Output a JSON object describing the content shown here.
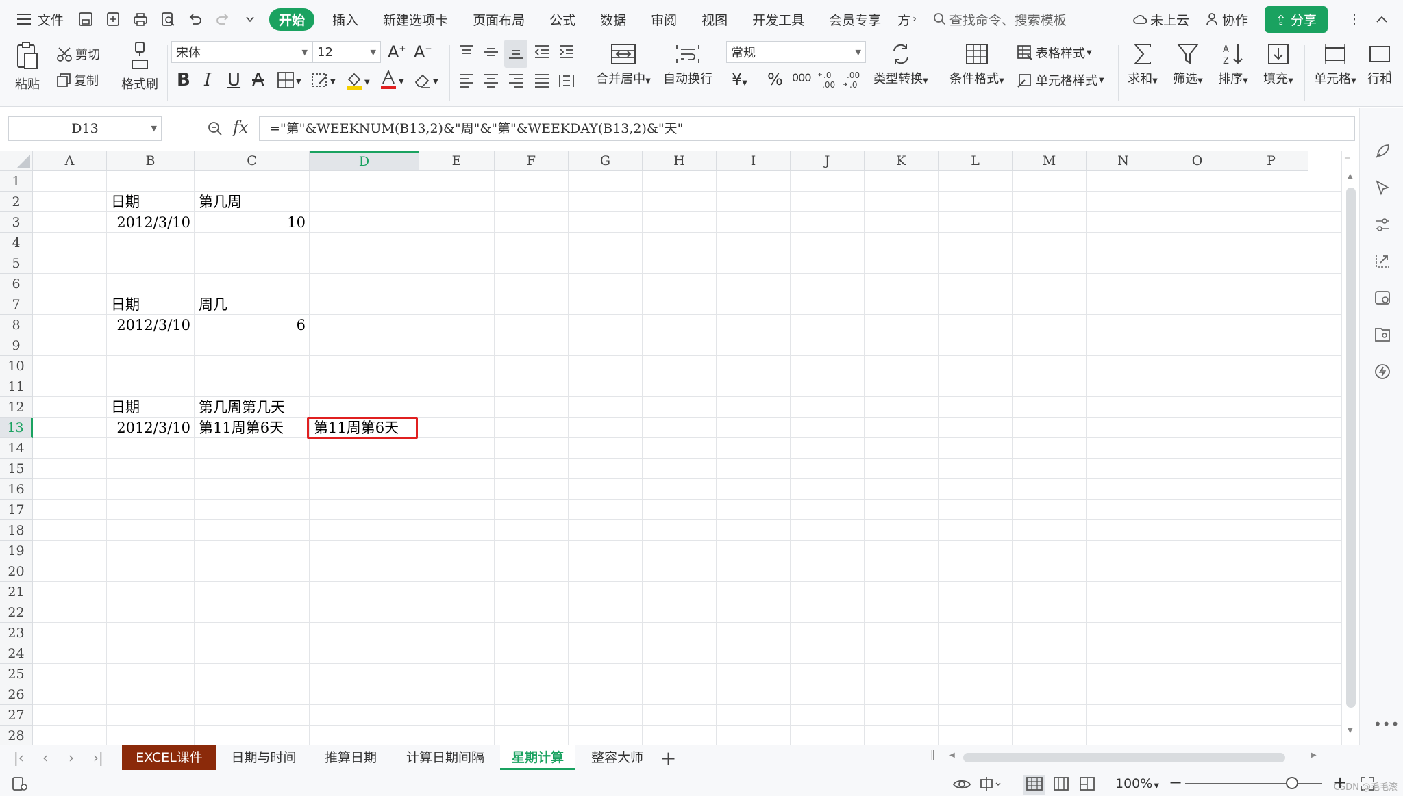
{
  "menu": {
    "file": "文件",
    "tabs": [
      "开始",
      "插入",
      "新建选项卡",
      "页面布局",
      "公式",
      "数据",
      "审阅",
      "视图",
      "开发工具",
      "会员专享",
      "方"
    ],
    "search_placeholder": "查找命令、搜索模板",
    "cloud": "未上云",
    "collab": "协作",
    "share": "分享"
  },
  "ribbon": {
    "paste": "粘贴",
    "cut": "剪切",
    "copy": "复制",
    "format_painter": "格式刷",
    "font_name": "宋体",
    "font_size": "12",
    "merge_center": "合并居中",
    "wrap_text": "自动换行",
    "number_format": "常规",
    "currency_symbol": "¥",
    "percent_symbol": "%",
    "thousands_symbol": "000",
    "type_convert": "类型转换",
    "cond_format": "条件格式",
    "table_style": "表格样式",
    "cell_style": "单元格样式",
    "sum": "求和",
    "filter": "筛选",
    "sort": "排序",
    "fill": "填充",
    "cell": "单元格",
    "row_col": "行和"
  },
  "formula_bar": {
    "name_box": "D13",
    "fx": "fx",
    "formula": "=\"第\"&WEEKNUM(B13,2)&\"周\"&\"第\"&WEEKDAY(B13,2)&\"天\""
  },
  "sheet": {
    "columns": [
      "A",
      "B",
      "C",
      "D",
      "E",
      "F",
      "G",
      "H",
      "I",
      "J",
      "K",
      "L",
      "M",
      "N",
      "O",
      "P"
    ],
    "active_column": "D",
    "active_row": 13,
    "rows": [
      1,
      2,
      3,
      4,
      5,
      6,
      7,
      8,
      9,
      10,
      11,
      12,
      13,
      14,
      15,
      16,
      17,
      18,
      19,
      20,
      21,
      22,
      23,
      24,
      25,
      26,
      27,
      28
    ],
    "cells": [
      {
        "ref": "B2",
        "text": "日期",
        "align": "left"
      },
      {
        "ref": "C2",
        "text": "第几周",
        "align": "left"
      },
      {
        "ref": "B3",
        "text": "2012/3/10",
        "align": "right"
      },
      {
        "ref": "C3",
        "text": "10",
        "align": "right"
      },
      {
        "ref": "B7",
        "text": "日期",
        "align": "left"
      },
      {
        "ref": "C7",
        "text": "周几",
        "align": "left"
      },
      {
        "ref": "B8",
        "text": "2012/3/10",
        "align": "right"
      },
      {
        "ref": "C8",
        "text": "6",
        "align": "right"
      },
      {
        "ref": "B12",
        "text": "日期",
        "align": "left"
      },
      {
        "ref": "C12",
        "text": "第几周第几天",
        "align": "left"
      },
      {
        "ref": "B13",
        "text": "2012/3/10",
        "align": "right"
      },
      {
        "ref": "C13",
        "text": "第11周第6天",
        "align": "left"
      },
      {
        "ref": "D13",
        "text": "第11周第6天",
        "align": "left"
      }
    ]
  },
  "sheet_tabs": [
    "EXCEL课件",
    "日期与时间",
    "推算日期",
    "计算日期间隔",
    "星期计算",
    "整容大师"
  ],
  "active_tab": "星期计算",
  "status": {
    "zoom": "100%",
    "watermark": "CSDN @毛毛滚"
  },
  "colors": {
    "accent": "#1aa260",
    "selection_border": "#e02020",
    "first_tab": "#8b2a0a"
  }
}
